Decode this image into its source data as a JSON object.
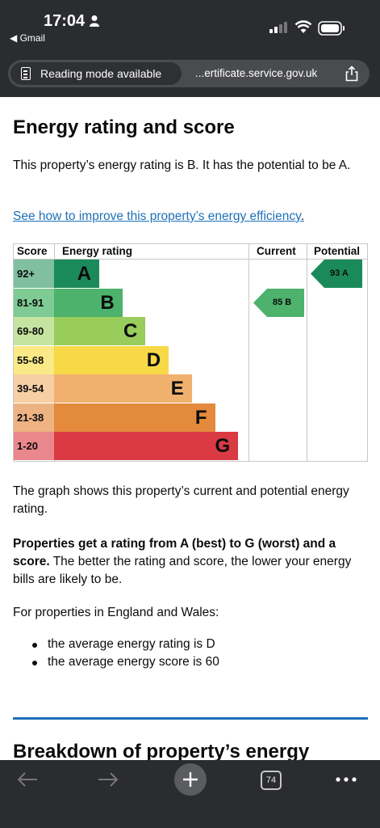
{
  "status_bar": {
    "time": "17:04",
    "back_app": "◀ Gmail"
  },
  "browser": {
    "reader_mode_label": "Reading mode available",
    "url": "...ertificate.service.gov.uk",
    "tab_count": "74"
  },
  "page": {
    "title": "Energy rating and score",
    "intro": "This property’s energy rating is B. It has the potential to be A.",
    "improve_link": "See how to improve this property’s energy efficiency",
    "improve_link_suffix": ".",
    "graph_description": "The graph shows this property’s current and potential energy rating.",
    "rating_scale_bold": "Properties get a rating from A (best) to G (worst) and a score.",
    "rating_scale_rest": " The better the rating and score, the lower your energy bills are likely to be.",
    "england_wales": "For properties in England and Wales:",
    "bullets": [
      "the average energy rating is D",
      "the average energy score is 60"
    ],
    "next_heading": "Breakdown of property’s energy"
  },
  "epc_chart": {
    "headers": {
      "score": "Score",
      "rating": "Energy rating",
      "current": "Current",
      "potential": "Potential"
    },
    "bands": [
      {
        "score": "92+",
        "letter": "A",
        "color": "#1b8a5a",
        "score_color": "#80c0a0"
      },
      {
        "score": "81-91",
        "letter": "B",
        "color": "#4db26b",
        "score_color": "#7ecb93"
      },
      {
        "score": "69-80",
        "letter": "C",
        "color": "#98cc5b",
        "score_color": "#c4e4a0"
      },
      {
        "score": "55-68",
        "letter": "D",
        "color": "#f7d948",
        "score_color": "#fae986"
      },
      {
        "score": "39-54",
        "letter": "E",
        "color": "#f0b16f",
        "score_color": "#f6cfa5"
      },
      {
        "score": "21-38",
        "letter": "F",
        "color": "#e38a3c",
        "score_color": "#eeb383"
      },
      {
        "score": "1-20",
        "letter": "G",
        "color": "#d93a44",
        "score_color": "#e9878d"
      }
    ],
    "current": {
      "label": "85 B",
      "band_index": 1,
      "color": "#4db26b"
    },
    "potential": {
      "label": "93 A",
      "band_index": 0,
      "color": "#1b8a5a"
    }
  }
}
